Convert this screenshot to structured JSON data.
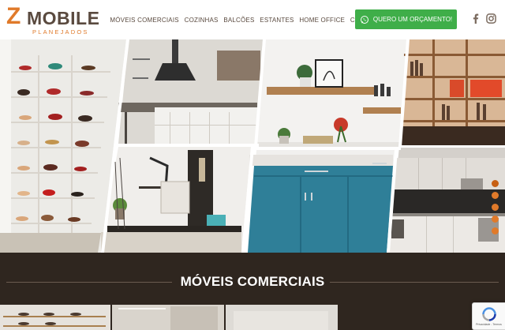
{
  "brand": {
    "mark": "Z",
    "word": "MOBILE",
    "sub": "PLANEJADOS"
  },
  "nav": {
    "items": [
      {
        "label": "MÓVEIS COMERCIAIS",
        "name": "nav-moveis-comerciais"
      },
      {
        "label": "COZINHAS",
        "name": "nav-cozinhas"
      },
      {
        "label": "BALCÕES",
        "name": "nav-balcoes"
      },
      {
        "label": "ESTANTES",
        "name": "nav-estantes"
      },
      {
        "label": "HOME OFFICE",
        "name": "nav-home-office"
      },
      {
        "label": "CONTATO",
        "name": "nav-contato"
      }
    ]
  },
  "cta": {
    "label": "QUERO UM ORÇAMENTO!",
    "icon": "whatsapp-icon"
  },
  "social": {
    "facebook_icon": "facebook-icon",
    "instagram_icon": "instagram-icon"
  },
  "carousel": {
    "slides": 5,
    "active_index": 0
  },
  "section": {
    "title": "MÓVEIS COMERCIAIS"
  },
  "recaptcha": {
    "text": "Privacidade - Termos"
  },
  "colors": {
    "accent": "#e07a2a",
    "cta_green": "#3fae49",
    "section_bg": "#2f261f",
    "text": "#5a4a3f"
  }
}
